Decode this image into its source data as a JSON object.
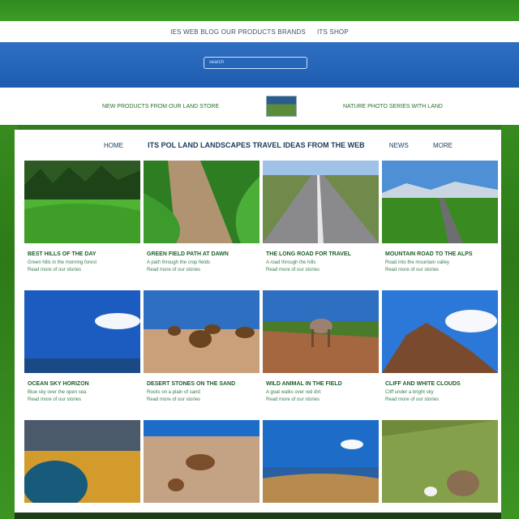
{
  "top_nav": {
    "links": [
      "IES WEB BLOG OUR PRODUCTS BRANDS",
      "ITS SHOP"
    ]
  },
  "search": {
    "placeholder": "search"
  },
  "sub_header": {
    "left": "NEW PRODUCTS FROM OUR LAND STORE",
    "right": "NATURE PHOTO SERIES WITH LAND"
  },
  "content_header": {
    "left": "HOME",
    "title": "ITS POL LAND LANDSCAPES TRAVEL IDEAS FROM THE WEB",
    "mid": "NEWS",
    "right": "MORE"
  },
  "tiles": [
    {
      "scene": "forest-hills",
      "l1": "BEST HILLS OF THE DAY",
      "l2": "Green hills in the morning forest",
      "l3": "Read more of our stories"
    },
    {
      "scene": "field-path",
      "l1": "GREEN FIELD PATH AT DAWN",
      "l2": "A path through the crop fields",
      "l3": "Read more of our stories"
    },
    {
      "scene": "road-hills",
      "l1": "THE LONG ROAD FOR TRAVEL",
      "l2": "A road through the hills",
      "l3": "Read more of our stories"
    },
    {
      "scene": "mountain-road",
      "l1": "MOUNTAIN ROAD TO THE ALPS",
      "l2": "Road into the mountain valley",
      "l3": "Read more of our stories"
    },
    {
      "scene": "ocean-sky",
      "l1": "OCEAN SKY HORIZON",
      "l2": "Blue sky over the open sea",
      "l3": "Read more of our stories"
    },
    {
      "scene": "desert-rocks",
      "l1": "DESERT STONES ON THE SAND",
      "l2": "Rocks on a plain of sand",
      "l3": "Read more of our stories"
    },
    {
      "scene": "animal-field",
      "l1": "WILD ANIMAL IN THE FIELD",
      "l2": "A goat walks over red dirt",
      "l3": "Read more of our stories"
    },
    {
      "scene": "cliff-clouds",
      "l1": "CLIFF AND WHITE CLOUDS",
      "l2": "Cliff under a bright sky",
      "l3": "Read more of our stories"
    },
    {
      "scene": "lake-cliffs",
      "l1": "",
      "l2": "",
      "l3": ""
    },
    {
      "scene": "desert-road",
      "l1": "",
      "l2": "",
      "l3": ""
    },
    {
      "scene": "shore-bushes",
      "l1": "",
      "l2": "",
      "l3": ""
    },
    {
      "scene": "rocky-hillside",
      "l1": "",
      "l2": "",
      "l3": ""
    }
  ]
}
